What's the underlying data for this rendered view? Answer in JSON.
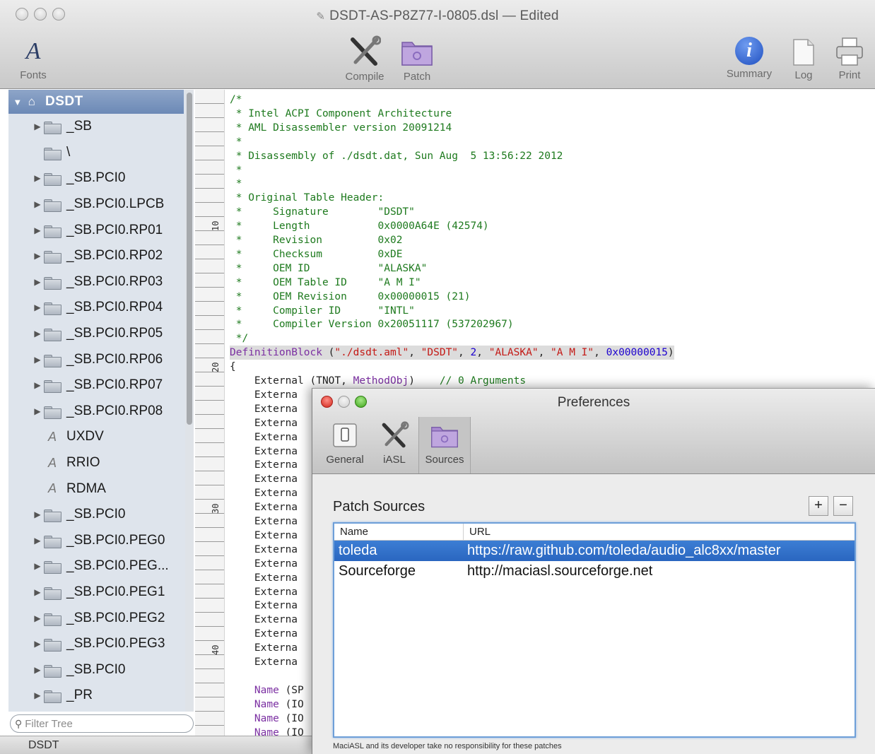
{
  "window": {
    "title": "DSDT-AS-P8Z77-I-0805.dsl",
    "title_suffix": " — Edited"
  },
  "toolbar": {
    "fonts_label": "Fonts",
    "compile_label": "Compile",
    "patch_label": "Patch",
    "summary_label": "Summary",
    "log_label": "Log",
    "print_label": "Print"
  },
  "sidebar": {
    "root_label": "DSDT",
    "items": [
      {
        "label": "_SB",
        "kind": "folder",
        "expandable": true
      },
      {
        "label": "\\",
        "kind": "folder",
        "expandable": false
      },
      {
        "label": "_SB.PCI0",
        "kind": "folder",
        "expandable": true
      },
      {
        "label": "_SB.PCI0.LPCB",
        "kind": "folder",
        "expandable": true
      },
      {
        "label": "_SB.PCI0.RP01",
        "kind": "folder",
        "expandable": true
      },
      {
        "label": "_SB.PCI0.RP02",
        "kind": "folder",
        "expandable": true
      },
      {
        "label": "_SB.PCI0.RP03",
        "kind": "folder",
        "expandable": true
      },
      {
        "label": "_SB.PCI0.RP04",
        "kind": "folder",
        "expandable": true
      },
      {
        "label": "_SB.PCI0.RP05",
        "kind": "folder",
        "expandable": true
      },
      {
        "label": "_SB.PCI0.RP06",
        "kind": "folder",
        "expandable": true
      },
      {
        "label": "_SB.PCI0.RP07",
        "kind": "folder",
        "expandable": true
      },
      {
        "label": "_SB.PCI0.RP08",
        "kind": "folder",
        "expandable": true
      },
      {
        "label": "UXDV",
        "kind": "method",
        "expandable": false
      },
      {
        "label": "RRIO",
        "kind": "method",
        "expandable": false
      },
      {
        "label": "RDMA",
        "kind": "method",
        "expandable": false
      },
      {
        "label": "_SB.PCI0",
        "kind": "folder",
        "expandable": true
      },
      {
        "label": "_SB.PCI0.PEG0",
        "kind": "folder",
        "expandable": true
      },
      {
        "label": "_SB.PCI0.PEG...",
        "kind": "folder",
        "expandable": true
      },
      {
        "label": "_SB.PCI0.PEG1",
        "kind": "folder",
        "expandable": true
      },
      {
        "label": "_SB.PCI0.PEG2",
        "kind": "folder",
        "expandable": true
      },
      {
        "label": "_SB.PCI0.PEG3",
        "kind": "folder",
        "expandable": true
      },
      {
        "label": "_SB.PCI0",
        "kind": "folder",
        "expandable": true
      },
      {
        "label": "_PR",
        "kind": "folder",
        "expandable": true
      }
    ],
    "filter_placeholder": "Filter Tree"
  },
  "statusbar": {
    "text": "DSDT"
  },
  "ruler": {
    "numbers": [
      "10",
      "20",
      "30",
      "40"
    ]
  },
  "code": {
    "lines": [
      [
        {
          "t": "/*",
          "c": "comment"
        }
      ],
      [
        {
          "t": " * Intel ACPI Component Architecture",
          "c": "comment"
        }
      ],
      [
        {
          "t": " * AML Disassembler version 20091214",
          "c": "comment"
        }
      ],
      [
        {
          "t": " *",
          "c": "comment"
        }
      ],
      [
        {
          "t": " * Disassembly of ./dsdt.dat, Sun Aug  5 13:56:22 2012",
          "c": "comment"
        }
      ],
      [
        {
          "t": " *",
          "c": "comment"
        }
      ],
      [
        {
          "t": " *",
          "c": "comment"
        }
      ],
      [
        {
          "t": " * Original Table Header:",
          "c": "comment"
        }
      ],
      [
        {
          "t": " *     Signature        \"DSDT\"",
          "c": "comment"
        }
      ],
      [
        {
          "t": " *     Length           0x0000A64E (42574)",
          "c": "comment"
        }
      ],
      [
        {
          "t": " *     Revision         0x02",
          "c": "comment"
        }
      ],
      [
        {
          "t": " *     Checksum         0xDE",
          "c": "comment"
        }
      ],
      [
        {
          "t": " *     OEM ID           \"ALASKA\"",
          "c": "comment"
        }
      ],
      [
        {
          "t": " *     OEM Table ID     \"A M I\"",
          "c": "comment"
        }
      ],
      [
        {
          "t": " *     OEM Revision     0x00000015 (21)",
          "c": "comment"
        }
      ],
      [
        {
          "t": " *     Compiler ID      \"INTL\"",
          "c": "comment"
        }
      ],
      [
        {
          "t": " *     Compiler Version 0x20051117 (537202967)",
          "c": "comment"
        }
      ],
      [
        {
          "t": " */",
          "c": "comment"
        }
      ],
      [
        {
          "t": "DefinitionBlock",
          "c": "kw"
        },
        {
          "t": " (",
          "c": "plain"
        },
        {
          "t": "\"./dsdt.aml\"",
          "c": "str"
        },
        {
          "t": ", ",
          "c": "plain"
        },
        {
          "t": "\"DSDT\"",
          "c": "str"
        },
        {
          "t": ", ",
          "c": "plain"
        },
        {
          "t": "2",
          "c": "num"
        },
        {
          "t": ", ",
          "c": "plain"
        },
        {
          "t": "\"ALASKA\"",
          "c": "str"
        },
        {
          "t": ", ",
          "c": "plain"
        },
        {
          "t": "\"A M I\"",
          "c": "str"
        },
        {
          "t": ", ",
          "c": "plain"
        },
        {
          "t": "0x00000015",
          "c": "num"
        },
        {
          "t": ")",
          "c": "plain"
        }
      ],
      [
        {
          "t": "{",
          "c": "plain"
        }
      ],
      [
        {
          "t": "    External (TNOT, ",
          "c": "plain"
        },
        {
          "t": "MethodObj",
          "c": "kw"
        },
        {
          "t": ")    ",
          "c": "plain"
        },
        {
          "t": "// 0 Arguments",
          "c": "comment"
        }
      ],
      [
        {
          "t": "    Externa",
          "c": "plain"
        }
      ],
      [
        {
          "t": "    Externa",
          "c": "plain"
        }
      ],
      [
        {
          "t": "    Externa",
          "c": "plain"
        }
      ],
      [
        {
          "t": "    Externa",
          "c": "plain"
        }
      ],
      [
        {
          "t": "    Externa",
          "c": "plain"
        }
      ],
      [
        {
          "t": "    Externa",
          "c": "plain"
        }
      ],
      [
        {
          "t": "    Externa",
          "c": "plain"
        }
      ],
      [
        {
          "t": "    Externa",
          "c": "plain"
        }
      ],
      [
        {
          "t": "    Externa",
          "c": "plain"
        }
      ],
      [
        {
          "t": "    Externa",
          "c": "plain"
        }
      ],
      [
        {
          "t": "    Externa",
          "c": "plain"
        }
      ],
      [
        {
          "t": "    Externa",
          "c": "plain"
        }
      ],
      [
        {
          "t": "    Externa",
          "c": "plain"
        }
      ],
      [
        {
          "t": "    Externa",
          "c": "plain"
        }
      ],
      [
        {
          "t": "    Externa",
          "c": "plain"
        }
      ],
      [
        {
          "t": "    Externa",
          "c": "plain"
        }
      ],
      [
        {
          "t": "    Externa",
          "c": "plain"
        }
      ],
      [
        {
          "t": "    Externa",
          "c": "plain"
        }
      ],
      [
        {
          "t": "    Externa",
          "c": "plain"
        }
      ],
      [
        {
          "t": "    Externa",
          "c": "plain"
        }
      ],
      [
        {
          "t": "",
          "c": "plain"
        }
      ],
      [
        {
          "t": "    Name",
          "c": "kw"
        },
        {
          "t": " (SP",
          "c": "plain"
        }
      ],
      [
        {
          "t": "    Name",
          "c": "kw"
        },
        {
          "t": " (IO",
          "c": "plain"
        }
      ],
      [
        {
          "t": "    Name",
          "c": "kw"
        },
        {
          "t": " (IO",
          "c": "plain"
        }
      ],
      [
        {
          "t": "    Name",
          "c": "kw"
        },
        {
          "t": " (IO",
          "c": "plain"
        }
      ]
    ]
  },
  "prefs": {
    "title": "Preferences",
    "tabs": [
      {
        "label": "General"
      },
      {
        "label": "iASL"
      },
      {
        "label": "Sources"
      }
    ],
    "heading": "Patch Sources",
    "add_label": "+",
    "remove_label": "−",
    "columns": {
      "name": "Name",
      "url": "URL"
    },
    "rows": [
      {
        "name": "toleda",
        "url": "https://raw.github.com/toleda/audio_alc8xx/master",
        "selected": true
      },
      {
        "name": "Sourceforge",
        "url": "http://maciasl.sourceforge.net",
        "selected": false
      }
    ],
    "disclaimer": "MaciASL and its developer take no responsibility for these patches"
  },
  "colors": {
    "selection": "#2a66c0",
    "sidebar_bg": "#dee4ec",
    "comment": "#1e7a1e",
    "keyword": "#7b2fa2",
    "string": "#c41a16",
    "number": "#1c00cf"
  }
}
